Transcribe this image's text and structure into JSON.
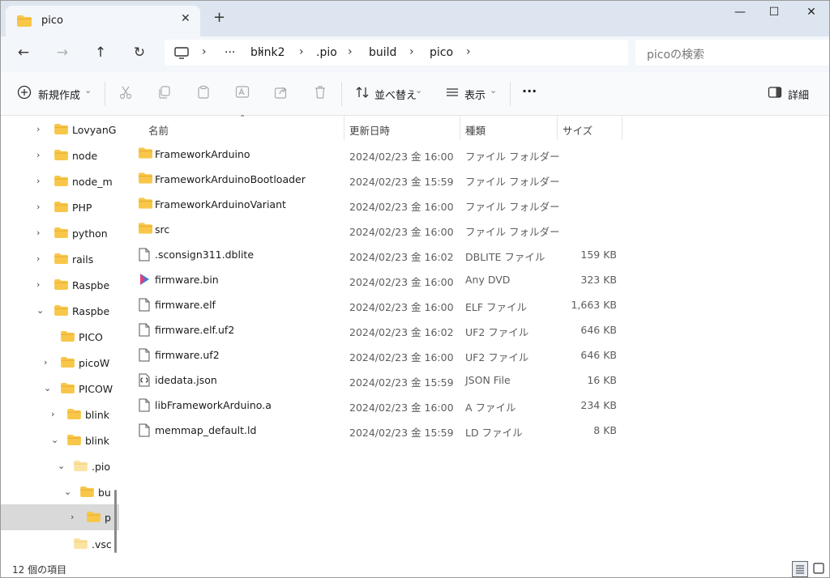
{
  "tab": {
    "title": "pico",
    "close": "✕",
    "new": "+"
  },
  "window": {
    "minimize": "—",
    "maximize": "☐",
    "close": "✕"
  },
  "nav": {
    "back": "←",
    "forward": "→",
    "up": "↑",
    "refresh": "↻"
  },
  "breadcrumb": {
    "more": "···",
    "items": [
      "blink2",
      ".pio",
      "build",
      "pico"
    ],
    "sep": "›"
  },
  "search": {
    "placeholder": "picoの検索"
  },
  "toolbar": {
    "new_label": "新規作成",
    "sort_label": "並べ替え",
    "view_label": "表示",
    "more_label": "···",
    "details_label": "詳細",
    "chevron": "⌄"
  },
  "navpane": {
    "items": [
      {
        "label": "LovyanG",
        "chevron": "›"
      },
      {
        "label": "node",
        "chevron": "›"
      },
      {
        "label": "node_m",
        "chevron": "›"
      },
      {
        "label": "PHP",
        "chevron": "›"
      },
      {
        "label": "python",
        "chevron": "›"
      },
      {
        "label": "rails",
        "chevron": "›"
      },
      {
        "label": "Raspbe",
        "chevron": "›"
      },
      {
        "label": "Raspbe",
        "chevron": "⌄"
      },
      {
        "label": "PICO",
        "chevron": ""
      },
      {
        "label": "picoW",
        "chevron": "›"
      },
      {
        "label": "PICOW",
        "chevron": "⌄"
      },
      {
        "label": "blink",
        "chevron": "›"
      },
      {
        "label": "blink",
        "chevron": "⌄"
      },
      {
        "label": ".pio",
        "chevron": "⌄"
      },
      {
        "label": "bu",
        "chevron": "⌄"
      },
      {
        "label": "p",
        "chevron": "›"
      },
      {
        "label": ".vsc",
        "chevron": ""
      }
    ]
  },
  "columns": {
    "name": "名前",
    "date": "更新日時",
    "type": "種類",
    "size": "サイズ",
    "sort_arrow": "⌃"
  },
  "files": [
    {
      "name": "FrameworkArduino",
      "date": "2024/02/23 金 16:00",
      "type": "ファイル フォルダー",
      "size": "",
      "icon": "folder"
    },
    {
      "name": "FrameworkArduinoBootloader",
      "date": "2024/02/23 金 15:59",
      "type": "ファイル フォルダー",
      "size": "",
      "icon": "folder"
    },
    {
      "name": "FrameworkArduinoVariant",
      "date": "2024/02/23 金 16:00",
      "type": "ファイル フォルダー",
      "size": "",
      "icon": "folder"
    },
    {
      "name": "src",
      "date": "2024/02/23 金 16:00",
      "type": "ファイル フォルダー",
      "size": "",
      "icon": "folder"
    },
    {
      "name": ".sconsign311.dblite",
      "date": "2024/02/23 金 16:02",
      "type": "DBLITE ファイル",
      "size": "159 KB",
      "icon": "file"
    },
    {
      "name": "firmware.bin",
      "date": "2024/02/23 金 16:00",
      "type": "Any DVD",
      "size": "323 KB",
      "icon": "media"
    },
    {
      "name": "firmware.elf",
      "date": "2024/02/23 金 16:00",
      "type": "ELF ファイル",
      "size": "1,663 KB",
      "icon": "file"
    },
    {
      "name": "firmware.elf.uf2",
      "date": "2024/02/23 金 16:02",
      "type": "UF2 ファイル",
      "size": "646 KB",
      "icon": "file"
    },
    {
      "name": "firmware.uf2",
      "date": "2024/02/23 金 16:00",
      "type": "UF2 ファイル",
      "size": "646 KB",
      "icon": "file"
    },
    {
      "name": "idedata.json",
      "date": "2024/02/23 金 15:59",
      "type": "JSON File",
      "size": "16 KB",
      "icon": "json"
    },
    {
      "name": "libFrameworkArduino.a",
      "date": "2024/02/23 金 16:00",
      "type": "A ファイル",
      "size": "234 KB",
      "icon": "file"
    },
    {
      "name": "memmap_default.ld",
      "date": "2024/02/23 金 15:59",
      "type": "LD ファイル",
      "size": "8 KB",
      "icon": "file"
    }
  ],
  "status": {
    "count": "12 個の項目"
  },
  "colors": {
    "folder": "#f8c74a",
    "folder_dark": "#e8a92c",
    "accent": "#0067c0"
  }
}
